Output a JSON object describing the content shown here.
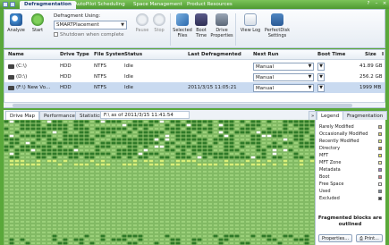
{
  "window": {
    "tabs": [
      "Defragmentation",
      "AutoPilot Scheduling",
      "Space Management",
      "Product Resources"
    ],
    "active_tab": 0,
    "controls": [
      "?",
      "–",
      "×"
    ]
  },
  "ribbon": {
    "analyze_label": "Analyze",
    "start_label": "Start",
    "method_label": "Defragment Using:",
    "method_value": "SMARTPlacement",
    "shutdown_label": "Shutdown when complete",
    "pause_label": "Pause",
    "stop_label": "Stop",
    "selected_files_label": "Selected Files",
    "boot_time_label": "Boot Time",
    "drive_properties_label": "Drive Properties",
    "view_log_label": "View Log",
    "perfectdisk_settings_label": "PerfectDisk Settings"
  },
  "table": {
    "headers": [
      "Name",
      "Drive Type",
      "File System",
      "Status",
      "Last Defragmented",
      "Next Run",
      "Boot Time",
      "Size",
      "I"
    ],
    "rows": [
      {
        "name": "(C:\\)",
        "type": "HDD",
        "fs": "NTFS",
        "status": "Idle",
        "last": "",
        "next": "Manual",
        "size": "41.89 GB",
        "selected": false
      },
      {
        "name": "(D:\\)",
        "type": "HDD",
        "fs": "NTFS",
        "status": "Idle",
        "last": "",
        "next": "Manual",
        "size": "256.2 GB",
        "selected": false
      },
      {
        "name": "(F:\\) New Vo...",
        "type": "HDD",
        "fs": "NTFS",
        "status": "Idle",
        "last": "2011/3/15 11:05:21",
        "next": "Manual",
        "size": "1999 MB",
        "selected": true
      }
    ]
  },
  "bottom_tabs": {
    "items": [
      "Drive Map",
      "Performance",
      "Statistics"
    ],
    "active": 0,
    "map_info": "F:\\ as of 2011/3/15 11:41:54"
  },
  "legend": {
    "tabs": [
      "Legend",
      "Fragmentation"
    ],
    "active": 0,
    "items": [
      {
        "label": "Rarely Modified",
        "color": "#c9b98a"
      },
      {
        "label": "Occasionally Modified",
        "color": "#d8d06a"
      },
      {
        "label": "Recently Modified",
        "color": "#d9ef7a"
      },
      {
        "label": "Directory",
        "color": "#b88a3a"
      },
      {
        "label": "MFT",
        "color": "#e8e848"
      },
      {
        "label": "MFT Zone",
        "color": "#f4f4a8"
      },
      {
        "label": "Metadata",
        "color": "#9a7ad0"
      },
      {
        "label": "Boot",
        "color": "#d07a7a"
      },
      {
        "label": "Free Space",
        "color": "#ffffff"
      },
      {
        "label": "Used",
        "color": "#7a8a9a"
      },
      {
        "label": "Excluded",
        "color": "#3a3a3a"
      }
    ],
    "fragmented_note": "Fragmented blocks are outlined",
    "properties_button": "Properties...",
    "print_button": "Print..."
  },
  "colors": {
    "accent": "#5aa83a",
    "map_free": "#9bd07a",
    "map_used": "#2f7a28",
    "map_modified": "#d9ef7a",
    "selected_row": "#c9daf0"
  }
}
